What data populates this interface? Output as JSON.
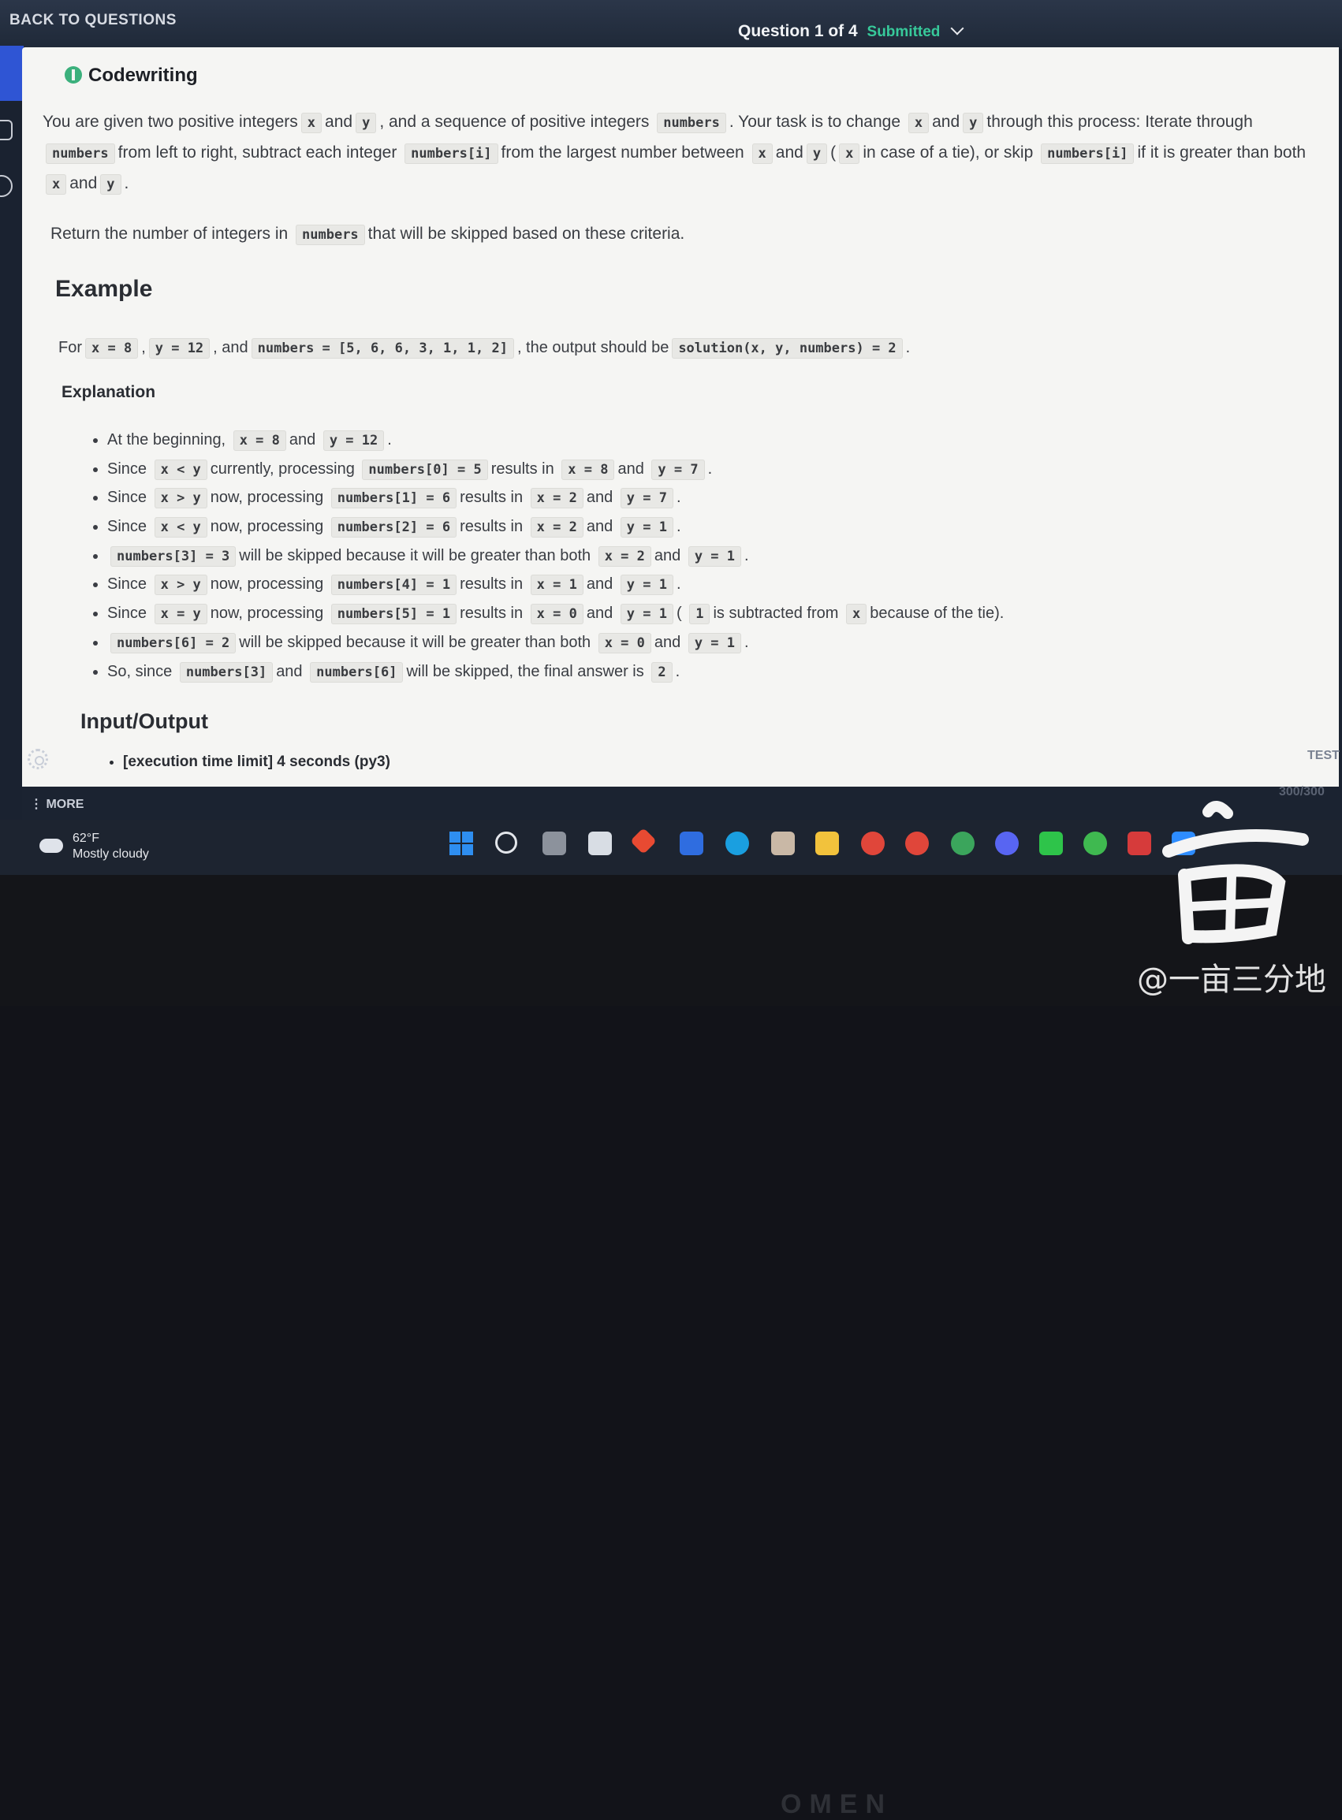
{
  "header": {
    "back_label": "BACK TO QUESTIONS",
    "question_progress": "Question 1 of 4",
    "status": "Submitted"
  },
  "problem": {
    "section_title": "Codewriting",
    "desc_line1": {
      "a": "You are given two positive integers",
      "x": "x",
      "and1": "and",
      "y": "y",
      "b": ", and a sequence of positive integers",
      "numbers": "numbers",
      "c": ". Your task is to change",
      "x2": "x",
      "and2": "and",
      "y2": "y",
      "d": "through this process: Iterate through"
    },
    "desc_line2": {
      "numbers": "numbers",
      "a": "from left to right, subtract each integer",
      "ni": "numbers[i]",
      "b": "from the largest number between",
      "x": "x",
      "and": "and",
      "y": "y",
      "c": "(",
      "x2": "x",
      "d": "in case of a tie), or skip",
      "ni2": "numbers[i]",
      "e": "if it is greater than both"
    },
    "desc_line3": {
      "x": "x",
      "and": "and",
      "y": "y",
      "end": "."
    },
    "return_line": {
      "a": "Return the number of integers in",
      "numbers": "numbers",
      "b": "that will be skipped based on these criteria."
    },
    "example_heading": "Example",
    "example_line": {
      "for": "For",
      "x": "x = 8",
      "comma": ",",
      "y": "y = 12",
      "and": ", and",
      "numbers": "numbers = [5, 6, 6, 3, 1, 1, 2]",
      "mid": ", the output should be",
      "sol": "solution(x, y, numbers) = 2",
      "end": "."
    },
    "explanation_heading": "Explanation",
    "explanation_items": [
      [
        "At the beginning,",
        "x = 8",
        "and",
        "y = 12",
        "."
      ],
      [
        "Since",
        "x < y",
        "currently, processing",
        "numbers[0] = 5",
        "results in",
        "x = 8",
        "and",
        "y = 7",
        "."
      ],
      [
        "Since",
        "x > y",
        "now, processing",
        "numbers[1] = 6",
        "results in",
        "x = 2",
        "and",
        "y = 7",
        "."
      ],
      [
        "Since",
        "x < y",
        "now, processing",
        "numbers[2] = 6",
        "results in",
        "x = 2",
        "and",
        "y = 1",
        "."
      ],
      [
        "",
        "numbers[3] = 3",
        "will be skipped because it will be greater than both",
        "x = 2",
        "and",
        "y = 1",
        "."
      ],
      [
        "Since",
        "x > y",
        "now, processing",
        "numbers[4] = 1",
        "results in",
        "x = 1",
        "and",
        "y = 1",
        "."
      ],
      [
        "Since",
        "x = y",
        "now, processing",
        "numbers[5] = 1",
        "results in",
        "x = 0",
        "and",
        "y = 1",
        "(",
        "1",
        "is subtracted from",
        "x",
        "because of the tie)."
      ],
      [
        "",
        "numbers[6] = 2",
        "will be skipped because it will be greater than both",
        "x = 0",
        "and",
        "y = 1",
        "."
      ],
      [
        "So, since",
        "numbers[3]",
        "and",
        "numbers[6]",
        "will be skipped, the final answer is",
        "2",
        "."
      ]
    ],
    "io_heading": "Input/Output",
    "io_items": [
      "[execution time limit] 4 seconds (py3)"
    ]
  },
  "sidebar": {
    "more_label": "MORE"
  },
  "right_panel": {
    "test_label": "TEST",
    "score": "300/300"
  },
  "taskbar": {
    "temperature": "62°F",
    "condition": "Mostly cloudy",
    "apps": [
      "start-icon",
      "search-icon",
      "task-view-icon",
      "store-icon",
      "git-icon",
      "app-icon",
      "edge-icon",
      "photo-icon",
      "file-explorer-icon",
      "chrome-icon",
      "chrome-icon",
      "chrome-icon",
      "discord-icon",
      "line-icon",
      "wechat-icon",
      "wps-icon",
      "zoom-icon"
    ]
  },
  "device": {
    "brand": "OMEN"
  },
  "watermark": "@一亩三分地"
}
